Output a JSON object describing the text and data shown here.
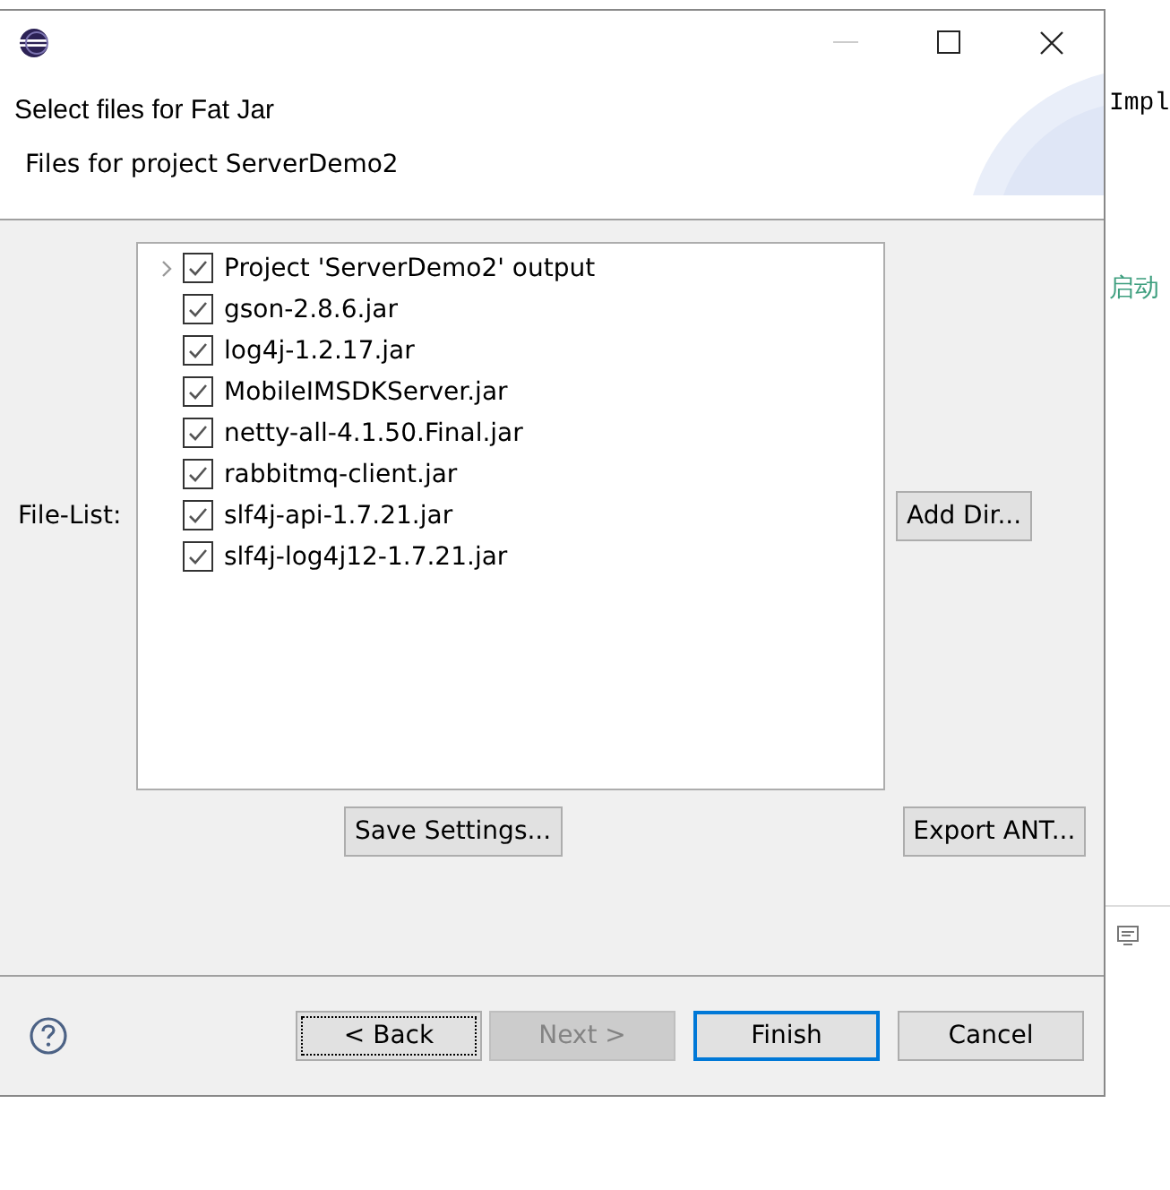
{
  "header": {
    "title": "Select files for Fat Jar",
    "subtitle": "Files for project ServerDemo2"
  },
  "file_list": {
    "label": "File-List:",
    "items": [
      {
        "label": "Project 'ServerDemo2' output",
        "kind": "folder",
        "checked": true
      },
      {
        "label": "gson-2.8.6.jar",
        "kind": "file",
        "checked": true
      },
      {
        "label": "log4j-1.2.17.jar",
        "kind": "file",
        "checked": true
      },
      {
        "label": "MobileIMSDKServer.jar",
        "kind": "file",
        "checked": true
      },
      {
        "label": "netty-all-4.1.50.Final.jar",
        "kind": "file",
        "checked": true
      },
      {
        "label": "rabbitmq-client.jar",
        "kind": "file",
        "checked": true
      },
      {
        "label": "slf4j-api-1.7.21.jar",
        "kind": "file",
        "checked": true
      },
      {
        "label": "slf4j-log4j12-1.7.21.jar",
        "kind": "file",
        "checked": true
      }
    ]
  },
  "add_dir_button": "Add Dir...",
  "save_settings_button": "Save Settings...",
  "export_ant_button": "Export ANT...",
  "footer_buttons": [
    {
      "label": "< Back",
      "disabled": false,
      "default": false,
      "focused": true
    },
    {
      "label": "Next >",
      "disabled": true,
      "default": false,
      "focused": false
    },
    {
      "label": "Finish",
      "disabled": false,
      "default": true,
      "focused": false
    },
    {
      "label": "Cancel",
      "disabled": false,
      "default": false,
      "focused": false
    }
  ],
  "background_editor": {
    "lines": [
      {
        "text": "Impl",
        "kind": "code"
      },
      {
        "text": "启动",
        "kind": "comment"
      }
    ]
  }
}
